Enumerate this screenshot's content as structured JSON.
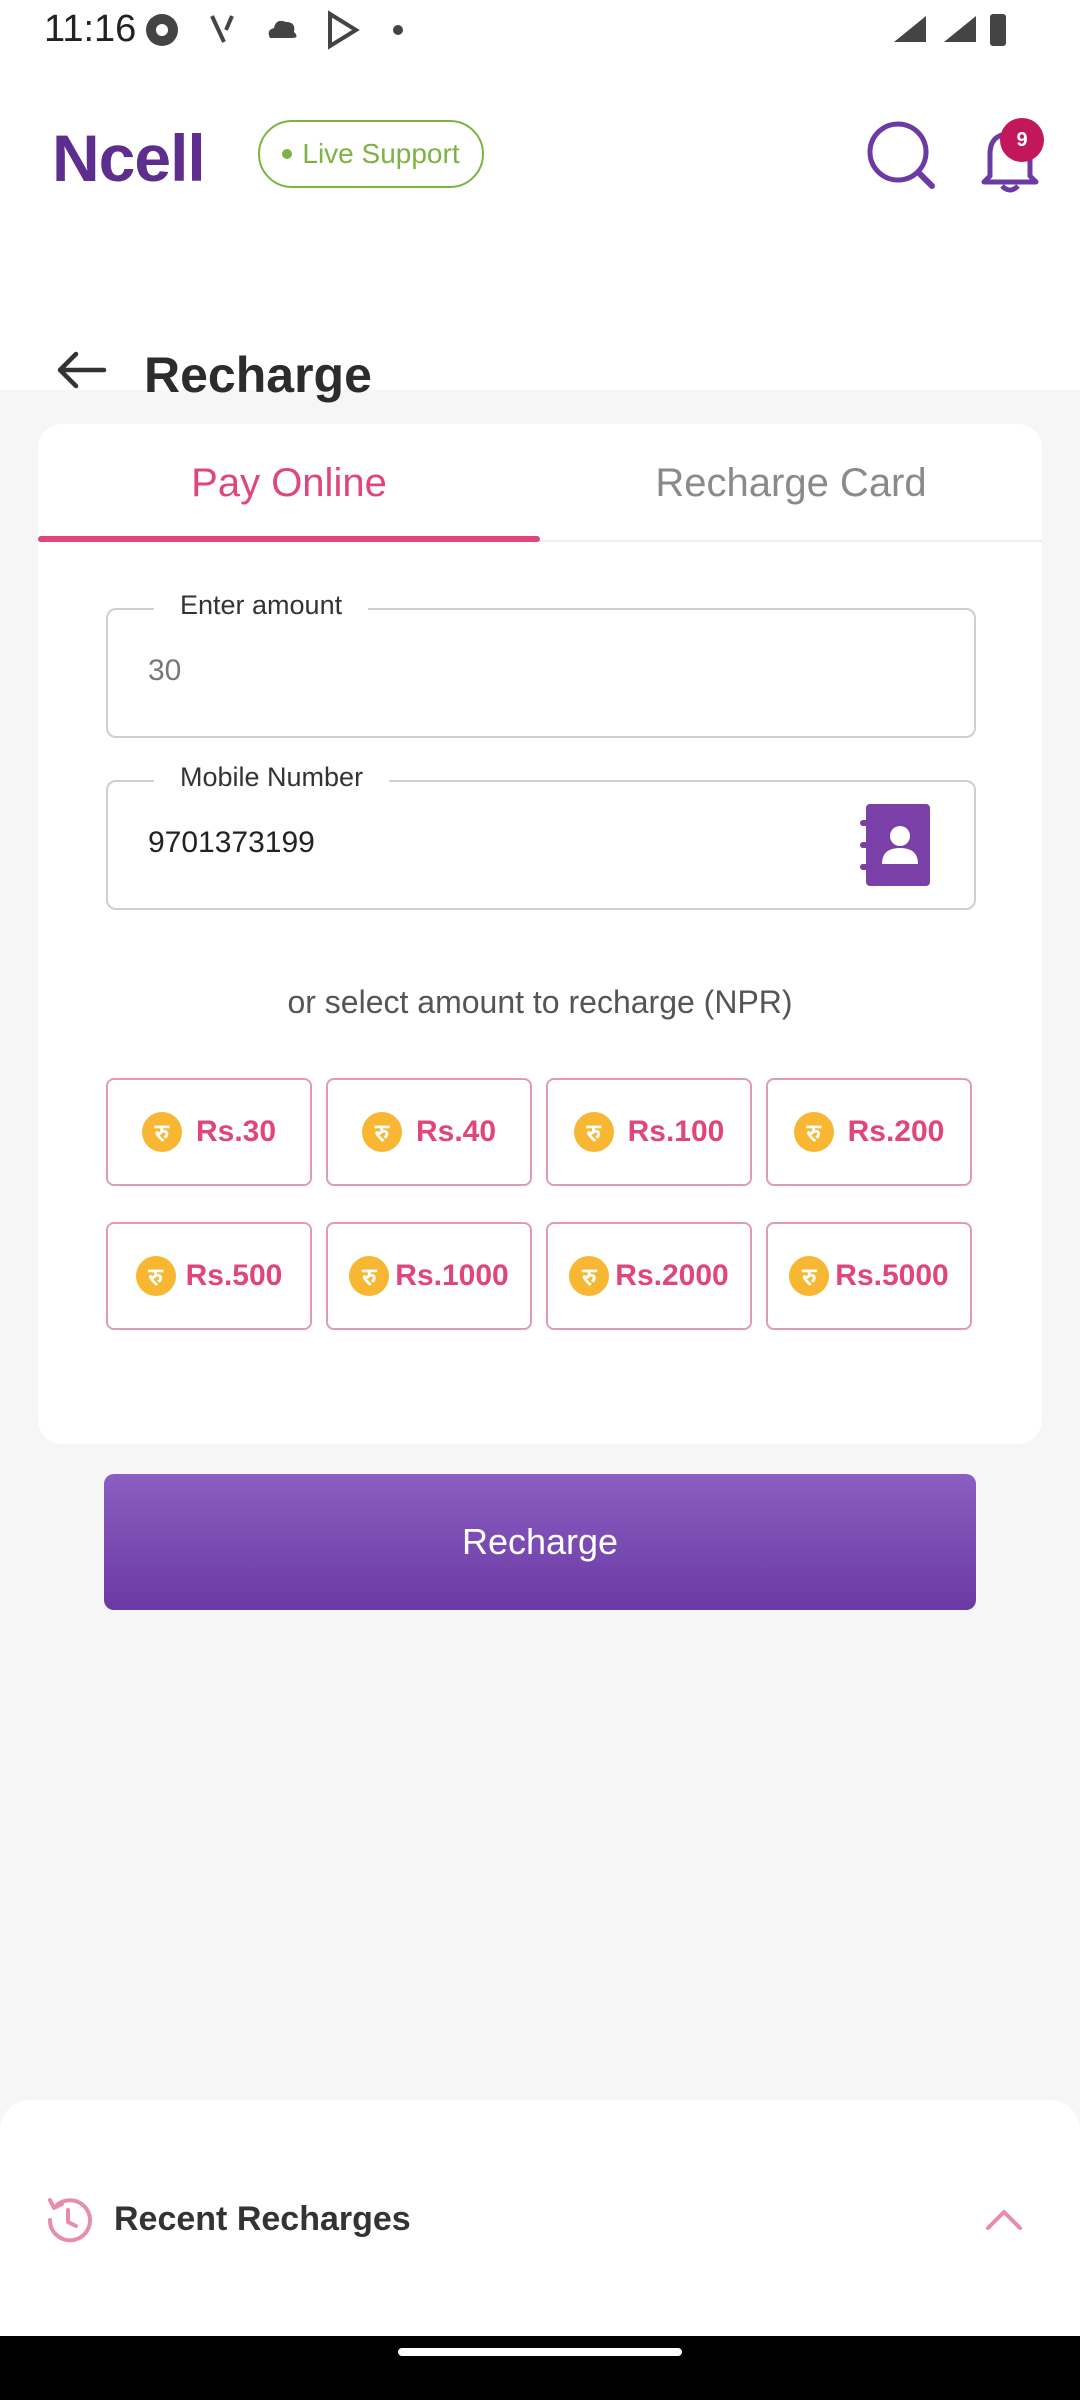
{
  "status_bar": {
    "time": "11:16"
  },
  "header": {
    "brand": "Ncell",
    "live_support": "Live Support",
    "notification_count": "9"
  },
  "page": {
    "title": "Recharge"
  },
  "tabs": [
    {
      "label": "Pay Online",
      "active": true
    },
    {
      "label": "Recharge Card",
      "active": false
    }
  ],
  "form": {
    "amount_label": "Enter amount",
    "amount_value": "30",
    "mobile_label": "Mobile Number",
    "mobile_value": "9701373199"
  },
  "quick_amounts": {
    "hint": "or select amount to recharge (NPR)",
    "coin_symbol": "रु",
    "items": [
      "Rs.30",
      "Rs.40",
      "Rs.100",
      "Rs.200",
      "Rs.500",
      "Rs.1000",
      "Rs.2000",
      "Rs.5000"
    ]
  },
  "actions": {
    "recharge_label": "Recharge"
  },
  "recent": {
    "title": "Recent Recharges"
  },
  "colors": {
    "brand_purple": "#5d2e8e",
    "accent_pink": "#e0457b",
    "live_green": "#7cb342",
    "coin_yellow": "#f7b733"
  }
}
